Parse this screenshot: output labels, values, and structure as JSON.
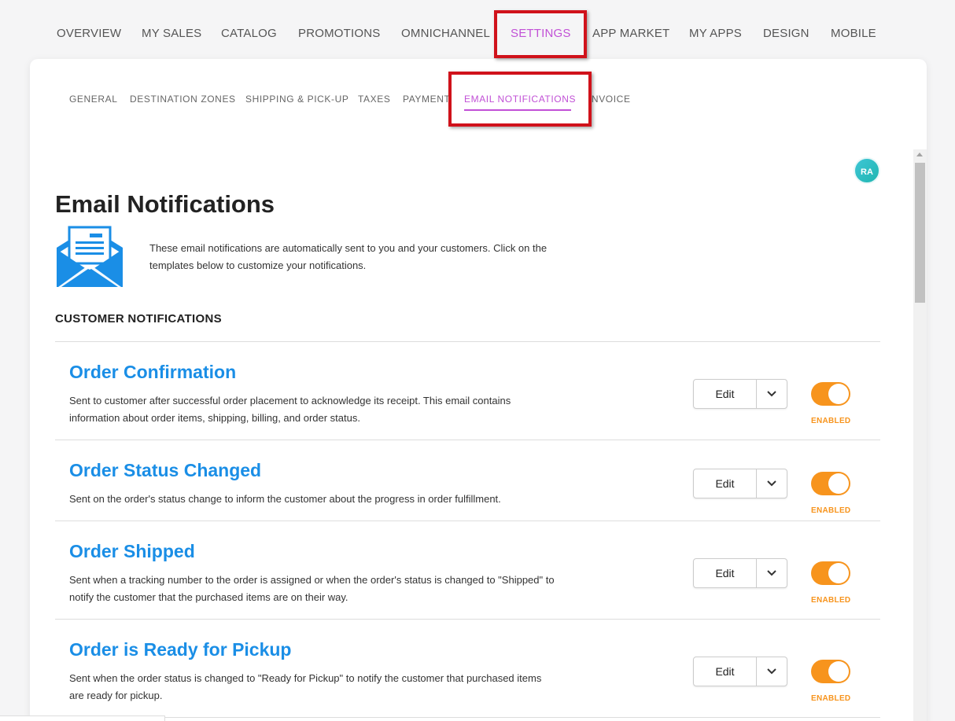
{
  "topnav": {
    "items": [
      {
        "label": "OVERVIEW"
      },
      {
        "label": "MY SALES"
      },
      {
        "label": "CATALOG"
      },
      {
        "label": "PROMOTIONS"
      },
      {
        "label": "OMNICHANNEL"
      },
      {
        "label": "SETTINGS"
      },
      {
        "label": "APP MARKET"
      },
      {
        "label": "MY APPS"
      },
      {
        "label": "DESIGN"
      },
      {
        "label": "MOBILE"
      }
    ],
    "active": "SETTINGS"
  },
  "subnav": {
    "items": [
      {
        "label": "GENERAL"
      },
      {
        "label": "DESTINATION ZONES"
      },
      {
        "label": "SHIPPING & PICK-UP"
      },
      {
        "label": "TAXES"
      },
      {
        "label": "PAYMENT"
      },
      {
        "label": "EMAIL NOTIFICATIONS"
      },
      {
        "label": "INVOICE"
      }
    ],
    "active": "EMAIL NOTIFICATIONS"
  },
  "avatar": {
    "initials": "RA"
  },
  "page": {
    "title": "Email Notifications",
    "intro": "These email notifications are automatically sent to you and your customers. Click on the templates below to customize your notifications.",
    "section_title": "CUSTOMER NOTIFICATIONS"
  },
  "notifications": [
    {
      "title": "Order Confirmation",
      "description": "Sent to customer after successful order placement to acknowledge its receipt. This email contains information about order items, shipping, billing, and order status.",
      "edit_label": "Edit",
      "status": "ENABLED"
    },
    {
      "title": "Order Status Changed",
      "description": "Sent on the order's status change to inform the customer about the progress in order fulfillment.",
      "edit_label": "Edit",
      "status": "ENABLED"
    },
    {
      "title": "Order Shipped",
      "description": "Sent when a tracking number to the order is assigned or when the order's status is changed to \"Shipped\" to notify the customer that the purchased items are on their way.",
      "edit_label": "Edit",
      "status": "ENABLED"
    },
    {
      "title": "Order is Ready for Pickup",
      "description": "Sent when the order status is changed to \"Ready for Pickup\" to notify the customer that purchased items are ready for pickup.",
      "edit_label": "Edit",
      "status": "ENABLED"
    }
  ],
  "colors": {
    "accent_active": "#c150d6",
    "link_blue": "#1a8ee6",
    "toggle_orange": "#f7941d",
    "highlight_red": "#d0121b"
  },
  "icons": {
    "envelope": "envelope-icon",
    "caret": "chevron-down-icon"
  }
}
